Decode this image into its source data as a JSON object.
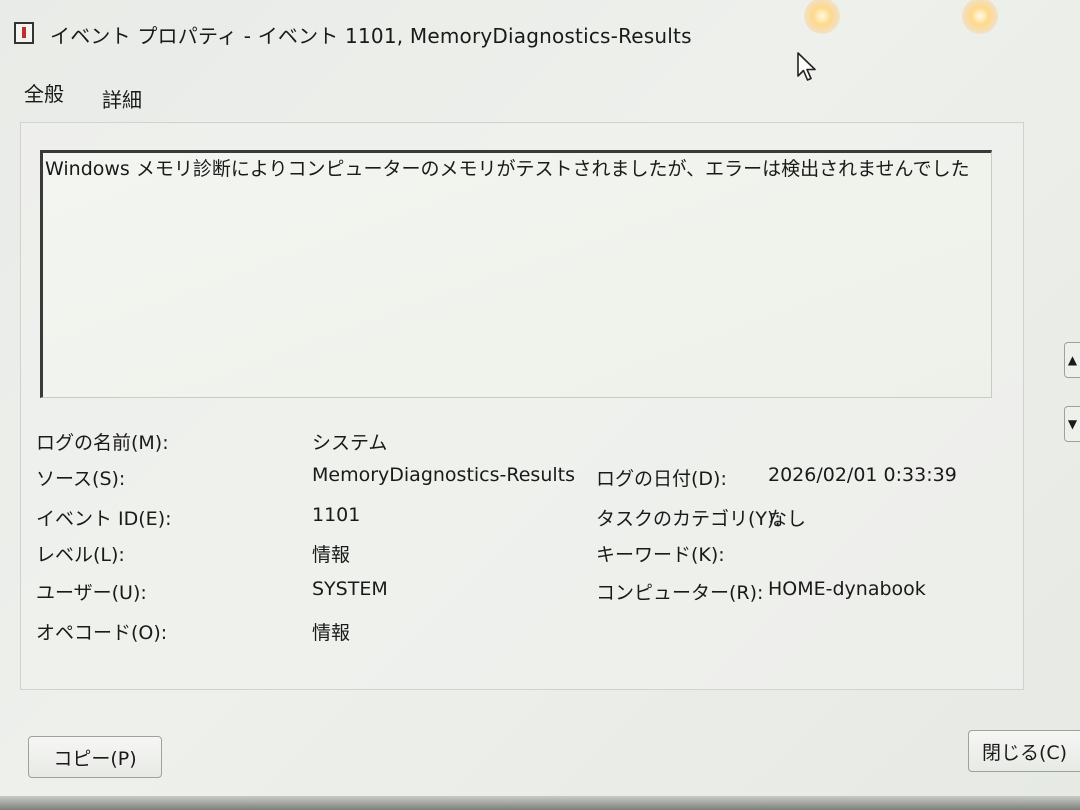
{
  "window": {
    "title": "イベント プロパティ - イベント 1101, MemoryDiagnostics-Results"
  },
  "tabs": [
    {
      "label": "全般"
    },
    {
      "label": "詳細"
    }
  ],
  "general": {
    "description": "Windows メモリ診断によりコンピューターのメモリがテストされましたが、エラーは検出されませんでした",
    "log_name_label": "ログの名前(M):",
    "log_name_value": "システム",
    "source_label": "ソース(S):",
    "source_value": "MemoryDiagnostics-Results",
    "logged_label": "ログの日付(D):",
    "logged_value": "2026/02/01 0:33:39",
    "event_id_label": "イベント ID(E):",
    "event_id_value": "1101",
    "task_category_label": "タスクのカテゴリ(Y):",
    "task_category_value": "なし",
    "level_label": "レベル(L):",
    "level_value": "情報",
    "keywords_label": "キーワード(K):",
    "keywords_value": "",
    "user_label": "ユーザー(U):",
    "user_value": "SYSTEM",
    "computer_label": "コンピューター(R):",
    "computer_value": "HOME-dynabook",
    "opcode_label": "オペコード(O):",
    "opcode_value": "情報"
  },
  "buttons": {
    "copy_label": "コピー(P)",
    "close_label": "閉じる(C)"
  },
  "icons": {
    "app": "event-viewer-icon",
    "cursor": "mouse-cursor-icon",
    "scroll_up": "up-arrow-icon",
    "scroll_down": "down-arrow-icon"
  }
}
